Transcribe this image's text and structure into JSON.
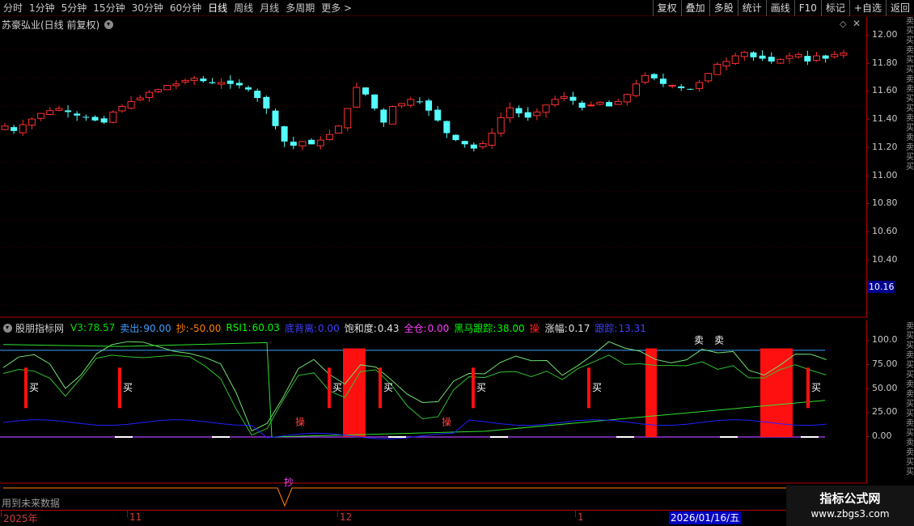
{
  "toolbar": {
    "periods": [
      "分时",
      "1分钟",
      "5分钟",
      "15分钟",
      "30分钟",
      "60分钟",
      "日线",
      "周线",
      "月线",
      "多周期",
      "更多 >"
    ],
    "active_period": "日线",
    "buttons": [
      "复权",
      "叠加",
      "多股",
      "统计",
      "画线",
      "F10",
      "标记",
      "+自选",
      "返回"
    ]
  },
  "main": {
    "title": "苏豪弘业(日线 前复权)",
    "price_ticks": [
      "12.00",
      "11.80",
      "11.60",
      "11.40",
      "11.20",
      "11.00",
      "10.80",
      "10.60",
      "10.40"
    ],
    "current_price": "10.16"
  },
  "indicator": {
    "name": "股朋指标网",
    "items": [
      {
        "label": "V3:",
        "value": "78.57",
        "color": "#00e000"
      },
      {
        "label": "卖出:",
        "value": "90.00",
        "color": "#40a0ff"
      },
      {
        "label": "抄:",
        "value": "-50.00",
        "color": "#ff8000"
      },
      {
        "label": "RSI1:",
        "value": "60.03",
        "color": "#00ff00"
      },
      {
        "label": "底背离:",
        "value": "0.00",
        "color": "#4040ff"
      },
      {
        "label": "饱和度:",
        "value": "0.43",
        "color": "#e0e0e0"
      },
      {
        "label": "全仓:",
        "value": "0.00",
        "color": "#ff40ff"
      },
      {
        "label": "黑马跟踪:",
        "value": "38.00",
        "color": "#00ff00"
      },
      {
        "label": "操",
        "value": "",
        "color": "#ff2020"
      },
      {
        "label": "涨幅:",
        "value": "0.17",
        "color": "#e0e0e0"
      },
      {
        "label": "跟踪:",
        "value": "13.31",
        "color": "#4040ff"
      }
    ],
    "axis_ticks": [
      "100.0",
      "75.00",
      "50.00",
      "25.00",
      "0.00"
    ],
    "buy_label": "买",
    "sell_label": "卖",
    "cao_label": "操",
    "chao_label": "抄"
  },
  "bottom": {
    "future_note": "用到未来数据",
    "date_labels": [
      "2025年",
      "11",
      "12",
      "1"
    ],
    "cursor_date": "2026/01/16/五"
  },
  "watermark": {
    "title": "指标公式网",
    "url": "www.zbgs3.com"
  },
  "side_strip": "卖买买卖买买卖卖买买卖买卖卖买买"
}
